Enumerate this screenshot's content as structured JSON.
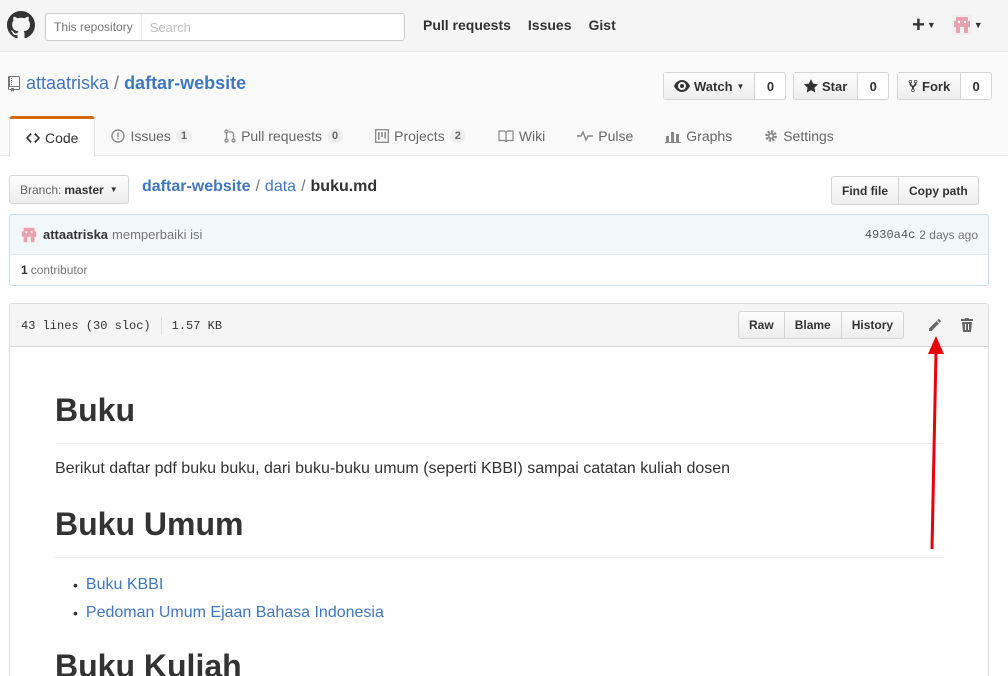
{
  "header": {
    "search_scope": "This repository",
    "search_placeholder": "Search",
    "nav": [
      "Pull requests",
      "Issues",
      "Gist"
    ],
    "plus": "+"
  },
  "repo": {
    "owner": "attaatriska",
    "separator": "/",
    "name": "daftar-website",
    "watch": {
      "label": "Watch",
      "count": "0"
    },
    "star": {
      "label": "Star",
      "count": "0"
    },
    "fork": {
      "label": "Fork",
      "count": "0"
    }
  },
  "tabs": [
    {
      "label": "Code",
      "icon": "code-icon",
      "counter": null,
      "selected": true
    },
    {
      "label": "Issues",
      "icon": "issue-icon",
      "counter": "1"
    },
    {
      "label": "Pull requests",
      "icon": "pull-request-icon",
      "counter": "0"
    },
    {
      "label": "Projects",
      "icon": "project-icon",
      "counter": "2"
    },
    {
      "label": "Wiki",
      "icon": "wiki-icon",
      "counter": null
    },
    {
      "label": "Pulse",
      "icon": "pulse-icon",
      "counter": null
    },
    {
      "label": "Graphs",
      "icon": "graph-icon",
      "counter": null
    },
    {
      "label": "Settings",
      "icon": "gear-icon",
      "counter": null
    }
  ],
  "file_nav": {
    "branch_label": "Branch:",
    "branch_value": "master",
    "breadcrumb_root": "daftar-website",
    "breadcrumb_sep": "/",
    "breadcrumb_dir": "data",
    "breadcrumb_file": "buku.md",
    "find_file": "Find file",
    "copy_path": "Copy path"
  },
  "commit": {
    "author": "attaatriska",
    "message": "memperbaiki isi",
    "sha": "4930a4c",
    "time": "2 days ago",
    "contributors_count": "1",
    "contributors_label": "contributor"
  },
  "file": {
    "lines": "43 lines (30 sloc)",
    "size": "1.57 KB",
    "actions": [
      "Raw",
      "Blame",
      "History"
    ]
  },
  "markdown": {
    "h1_title": "Buku",
    "intro": "Berikut daftar pdf buku buku, dari buku-buku umum (seperti KBBI) sampai catatan kuliah dosen",
    "h1_umum": "Buku Umum",
    "links": [
      "Buku KBBI",
      "Pedoman Umum Ejaan Bahasa Indonesia"
    ],
    "h1_kuliah": "Buku Kuliah"
  },
  "colors": {
    "accent_link": "#4078c0",
    "tab_highlight": "#d26911",
    "annotation_arrow": "#e8000b"
  }
}
